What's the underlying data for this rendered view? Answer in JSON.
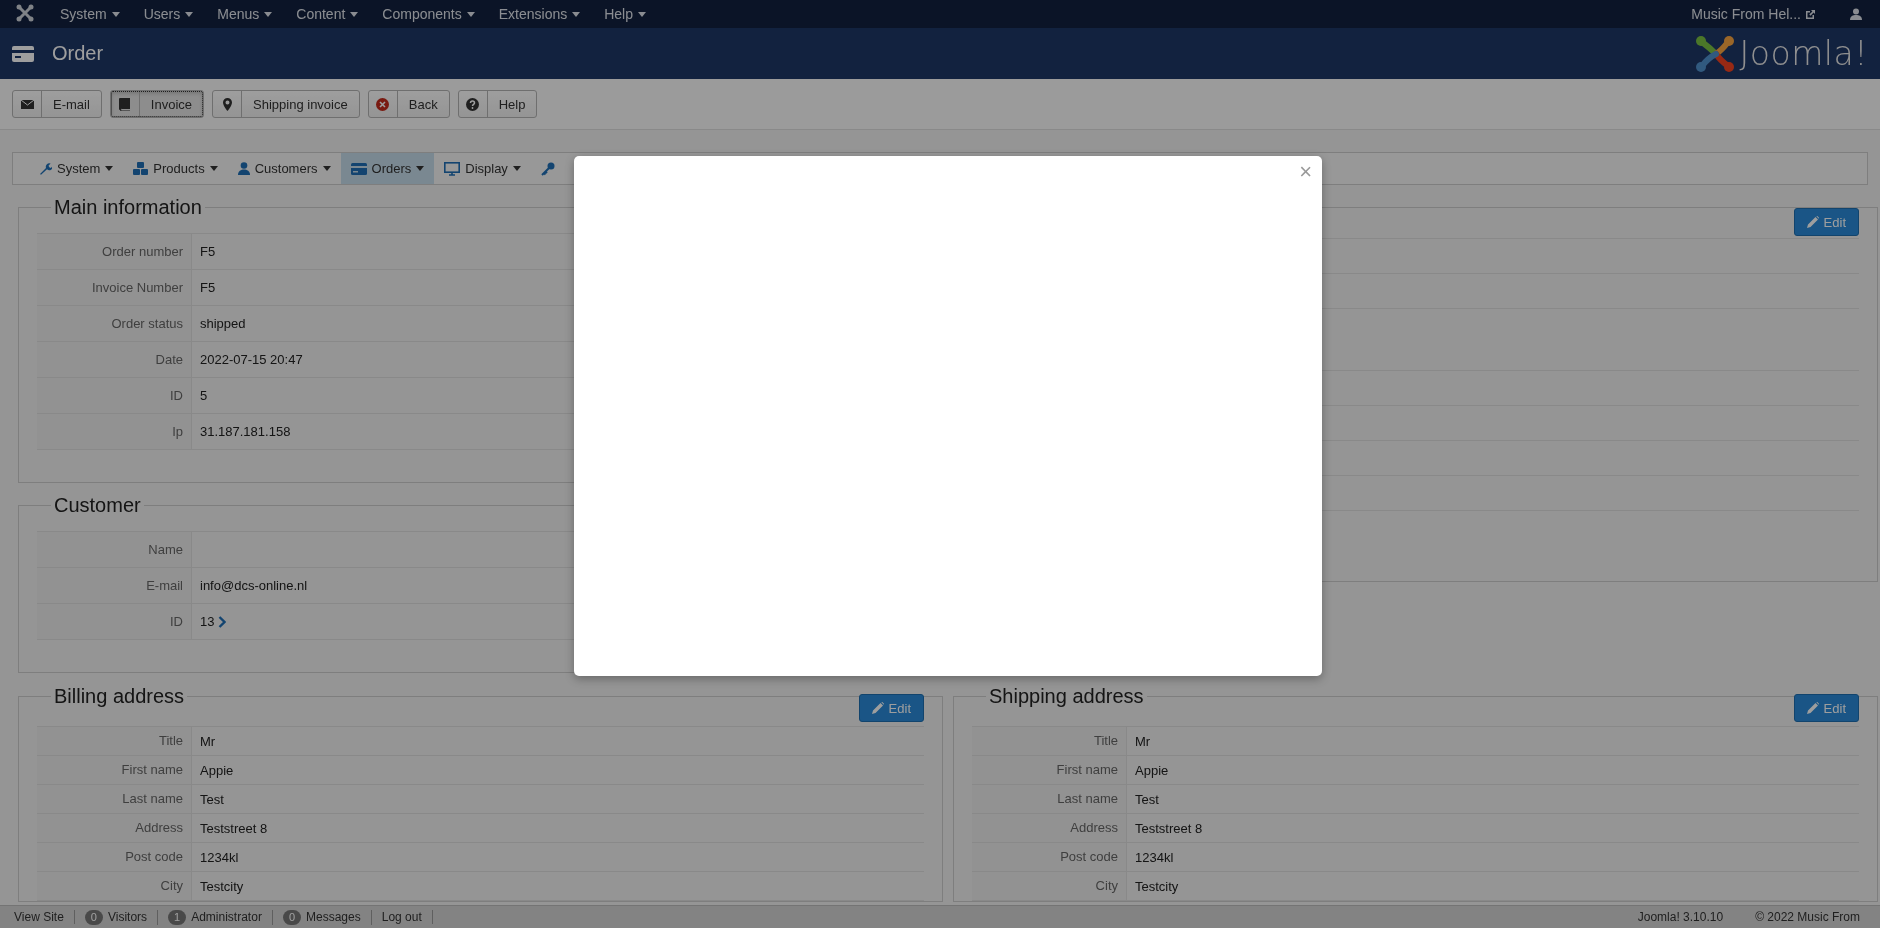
{
  "top_menu": {
    "items": [
      {
        "label": "System"
      },
      {
        "label": "Users"
      },
      {
        "label": "Menus"
      },
      {
        "label": "Content"
      },
      {
        "label": "Components"
      },
      {
        "label": "Extensions"
      },
      {
        "label": "Help"
      }
    ],
    "site_link": "Music From Hel..."
  },
  "header": {
    "title": "Order",
    "logo_text": "Joomla!"
  },
  "toolbar": [
    {
      "label": "E-mail",
      "pressed": false
    },
    {
      "label": "Invoice",
      "pressed": true
    },
    {
      "label": "Shipping invoice",
      "pressed": false
    },
    {
      "label": "Back",
      "pressed": false
    },
    {
      "label": "Help",
      "pressed": false
    }
  ],
  "submenu": [
    {
      "label": "System",
      "selected": false
    },
    {
      "label": "Products",
      "selected": false
    },
    {
      "label": "Customers",
      "selected": false
    },
    {
      "label": "Orders",
      "selected": true
    },
    {
      "label": "Display",
      "selected": false
    },
    {
      "selected": false
    }
  ],
  "main_information": {
    "legend": "Main information",
    "rows": [
      {
        "label": "Order number",
        "value": "F5"
      },
      {
        "label": "Invoice Number",
        "value": "F5"
      },
      {
        "label": "Order status",
        "value": "shipped"
      },
      {
        "label": "Date",
        "value": "2022-07-15 20:47"
      },
      {
        "label": "ID",
        "value": "5"
      },
      {
        "label": "Ip",
        "value": "31.187.181.158"
      }
    ]
  },
  "customer": {
    "legend": "Customer",
    "rows": [
      {
        "label": "Name"
      },
      {
        "label": "E-mail",
        "value": "info@dcs-online.nl"
      },
      {
        "label": "ID",
        "value": "13",
        "link": true
      }
    ]
  },
  "right_panel": {
    "edit_button": "Edit"
  },
  "billing_address": {
    "legend": "Billing address",
    "edit_button": "Edit",
    "rows": [
      {
        "label": "Title",
        "value": "Mr"
      },
      {
        "label": "First name",
        "value": "Appie"
      },
      {
        "label": "Last name",
        "value": "Test"
      },
      {
        "label": "Address",
        "value": "Teststreet 8"
      },
      {
        "label": "Post code",
        "value": "1234kl"
      },
      {
        "label": "City",
        "value": "Testcity"
      }
    ]
  },
  "shipping_address": {
    "legend": "Shipping address",
    "edit_button": "Edit",
    "rows": [
      {
        "label": "Title",
        "value": "Mr"
      },
      {
        "label": "First name",
        "value": "Appie"
      },
      {
        "label": "Last name",
        "value": "Test"
      },
      {
        "label": "Address",
        "value": "Teststreet 8"
      },
      {
        "label": "Post code",
        "value": "1234kl"
      },
      {
        "label": "City",
        "value": "Testcity"
      }
    ]
  },
  "modal": {
    "close": "×"
  },
  "status_bar": {
    "left": [
      {
        "label": "View Site"
      },
      {
        "count": "0",
        "label": "Visitors"
      },
      {
        "count": "1",
        "label": "Administrator"
      },
      {
        "count": "0",
        "label": "Messages"
      },
      {
        "label": "Log out"
      }
    ],
    "right": [
      "Joomla! 3.10.10",
      "© 2022 Music From"
    ]
  }
}
